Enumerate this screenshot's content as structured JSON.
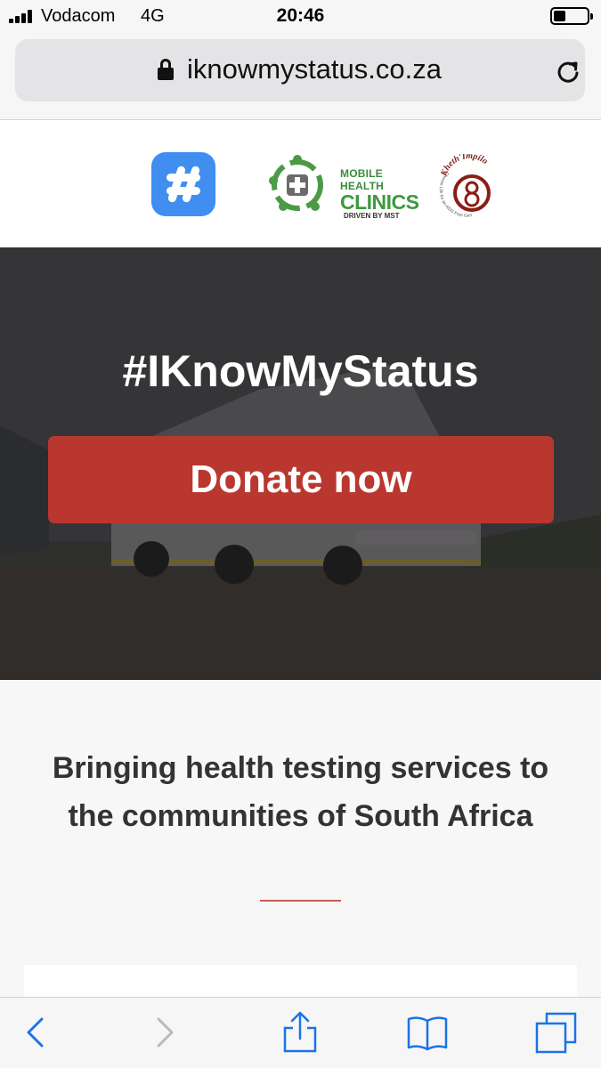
{
  "status_bar": {
    "carrier": "Vodacom",
    "network": "4G",
    "time": "20:46",
    "battery_level": 0.35
  },
  "browser": {
    "url": "iknowmystatus.co.za",
    "icons": [
      "lock-icon",
      "reload-icon"
    ]
  },
  "logos": {
    "mhc_line1": "MOBILE HEALTH",
    "mhc_line2": "CLINICS",
    "mhc_line3": "DRIVEN BY MST",
    "kheth_name": "Kheth'Impilo",
    "kheth_tagline": "Choose Life for an AIDS Free Generation"
  },
  "hero": {
    "heading": "#IKnowMyStatus",
    "donate_label": "Donate now"
  },
  "content": {
    "tagline": "Bringing health testing services to the communities of South Africa",
    "accent_color": "#b9372f"
  },
  "toolbar": {
    "icons": [
      "back-icon",
      "forward-icon",
      "share-icon",
      "bookmarks-icon",
      "tabs-icon"
    ],
    "tint_color": "#1a73e8"
  }
}
